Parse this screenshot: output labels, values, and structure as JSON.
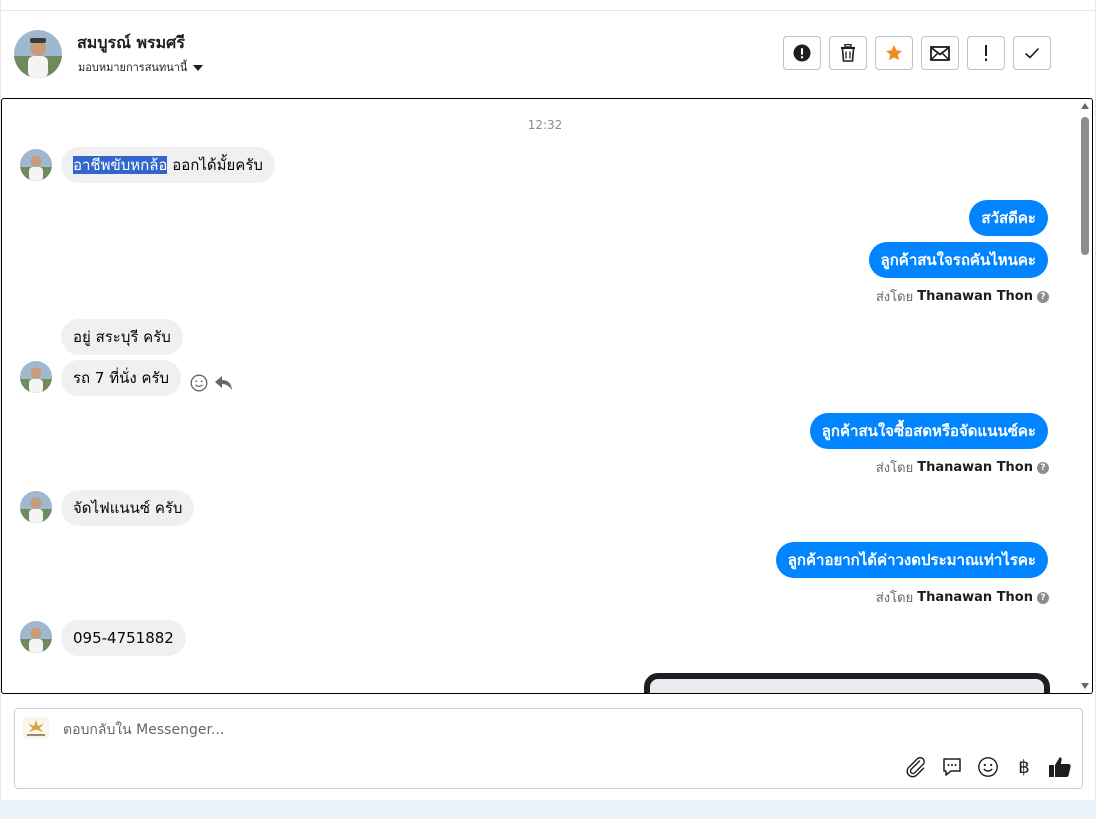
{
  "header": {
    "contact_name": "สมบูรณ์ พรมศรี",
    "assign_label": "มอบหมายการสนทนานี้"
  },
  "icons": {
    "report": "exclamation-circle-icon",
    "delete": "trash-icon",
    "star": "star-icon",
    "mark_unread": "envelope-icon",
    "important": "exclamation-icon",
    "done": "check-icon"
  },
  "colors": {
    "outgoing_bubble": "#0084ff",
    "incoming_bubble": "#f0f0f0",
    "star": "#f28a22"
  },
  "thread": {
    "timestamp": "12:32",
    "messages": [
      {
        "dir": "in",
        "text_selected": "อาชีพขับหกล้อ",
        "text": " ออกได้มั้ยครับ"
      },
      {
        "dir": "out",
        "text": "สวัสดีคะ"
      },
      {
        "dir": "out",
        "text": "ลูกค้าสนใจรถคันไหนคะ"
      },
      {
        "dir": "in",
        "text": "อยู่ สระบุรี ครับ"
      },
      {
        "dir": "in",
        "text": "รถ 7 ที่นั่ง ครับ"
      },
      {
        "dir": "out",
        "text": "ลูกค้าสนใจซื้อสดหรือจัดแนนซ์คะ"
      },
      {
        "dir": "in",
        "text": "จัดไฟแนนซ์ ครับ"
      },
      {
        "dir": "out",
        "text": "ลูกค้าอยากได้ค่าวงดประมาณเท่าไรคะ"
      },
      {
        "dir": "in",
        "text": "095-4751882"
      }
    ],
    "sent_by_label": "ส่งโดย",
    "agent_name": "Thanawan Thon",
    "help_glyph": "?"
  },
  "composer": {
    "placeholder": "ตอบกลับใน Messenger...",
    "currency_symbol": "฿"
  }
}
